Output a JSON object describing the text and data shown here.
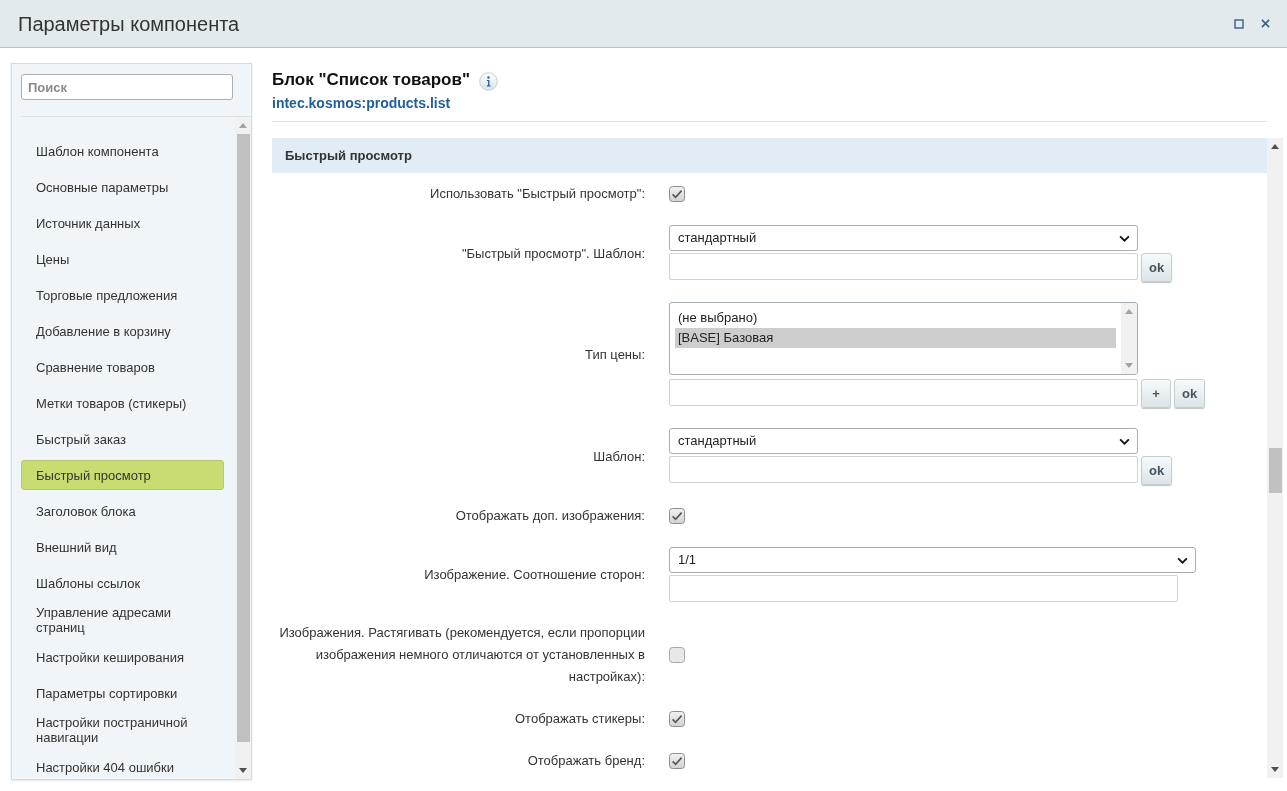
{
  "window": {
    "title": "Параметры компонента"
  },
  "sidebar": {
    "search": {
      "placeholder": "Поиск"
    },
    "items": [
      {
        "label": "Шаблон компонента",
        "selected": false
      },
      {
        "label": "Основные параметры",
        "selected": false
      },
      {
        "label": "Источник данных",
        "selected": false
      },
      {
        "label": "Цены",
        "selected": false
      },
      {
        "label": "Торговые предложения",
        "selected": false
      },
      {
        "label": "Добавление в корзину",
        "selected": false
      },
      {
        "label": "Сравнение товаров",
        "selected": false
      },
      {
        "label": "Метки товаров (стикеры)",
        "selected": false
      },
      {
        "label": "Быстрый заказ",
        "selected": false
      },
      {
        "label": "Быстрый просмотр",
        "selected": true
      },
      {
        "label": "Заголовок блока",
        "selected": false
      },
      {
        "label": "Внешний вид",
        "selected": false
      },
      {
        "label": "Шаблоны ссылок",
        "selected": false
      },
      {
        "label": "Управление адресами страниц",
        "selected": false
      },
      {
        "label": "Настройки кеширования",
        "selected": false
      },
      {
        "label": "Параметры сортировки",
        "selected": false
      },
      {
        "label": "Настройки постраничной навигации",
        "selected": false
      },
      {
        "label": "Настройки 404 ошибки",
        "selected": false
      }
    ]
  },
  "component": {
    "title": "Блок \"Список товаров\"",
    "code": "intec.kosmos:products.list"
  },
  "section": {
    "title": "Быстрый просмотр"
  },
  "fields": [
    {
      "kind": "checkbox",
      "label": "Использовать \"Быстрый просмотр\":",
      "checked": true
    },
    {
      "kind": "select",
      "label": "\"Быстрый просмотр\". Шаблон:",
      "value": "стандартный",
      "buttons": [
        "ok"
      ]
    },
    {
      "kind": "listbox",
      "label": "Тип цены:",
      "options": [
        {
          "label": "(не выбрано)",
          "selected": false
        },
        {
          "label": "[BASE] Базовая",
          "selected": true
        }
      ],
      "buttons": [
        "+",
        "ok"
      ]
    },
    {
      "kind": "select",
      "label": "Шаблон:",
      "value": "стандартный",
      "buttons": [
        "ok"
      ]
    },
    {
      "kind": "checkbox",
      "label": "Отображать доп. изображения:",
      "checked": true
    },
    {
      "kind": "select",
      "label": "Изображение. Соотношение сторон:",
      "value": "1/1"
    },
    {
      "kind": "checkbox",
      "label": "Изображения. Растягивать (рекомендуется, если пропорции изображения немного отличаются от установленных в настройках):",
      "checked": false
    },
    {
      "kind": "checkbox",
      "label": "Отображать стикеры:",
      "checked": true
    },
    {
      "kind": "checkbox",
      "label": "Отображать бренд:",
      "checked": true
    }
  ]
}
